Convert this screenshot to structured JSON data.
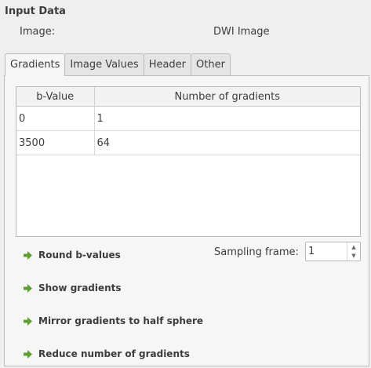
{
  "input_data": {
    "title": "Input Data",
    "image_label": "Image:",
    "image_value": "DWI Image"
  },
  "tabs": [
    {
      "label": "Gradients",
      "active": true
    },
    {
      "label": "Image Values",
      "active": false
    },
    {
      "label": "Header",
      "active": false
    },
    {
      "label": "Other",
      "active": false
    }
  ],
  "gradients_table": {
    "columns": [
      "b-Value",
      "Number of gradients"
    ],
    "rows": [
      [
        "0",
        "1"
      ],
      [
        "3500",
        "64"
      ]
    ]
  },
  "actions": [
    {
      "label": "Round b-values",
      "icon": "green-arrow-icon"
    },
    {
      "label": "Show gradients",
      "icon": "green-arrow-icon"
    },
    {
      "label": "Mirror gradients to half sphere",
      "icon": "green-arrow-icon"
    },
    {
      "label": "Reduce number of gradients",
      "icon": "green-arrow-icon"
    }
  ],
  "sampling_frame": {
    "label": "Sampling frame:",
    "value": "1"
  },
  "colors": {
    "action_arrow": "#5aa02c",
    "background": "#efefef"
  }
}
